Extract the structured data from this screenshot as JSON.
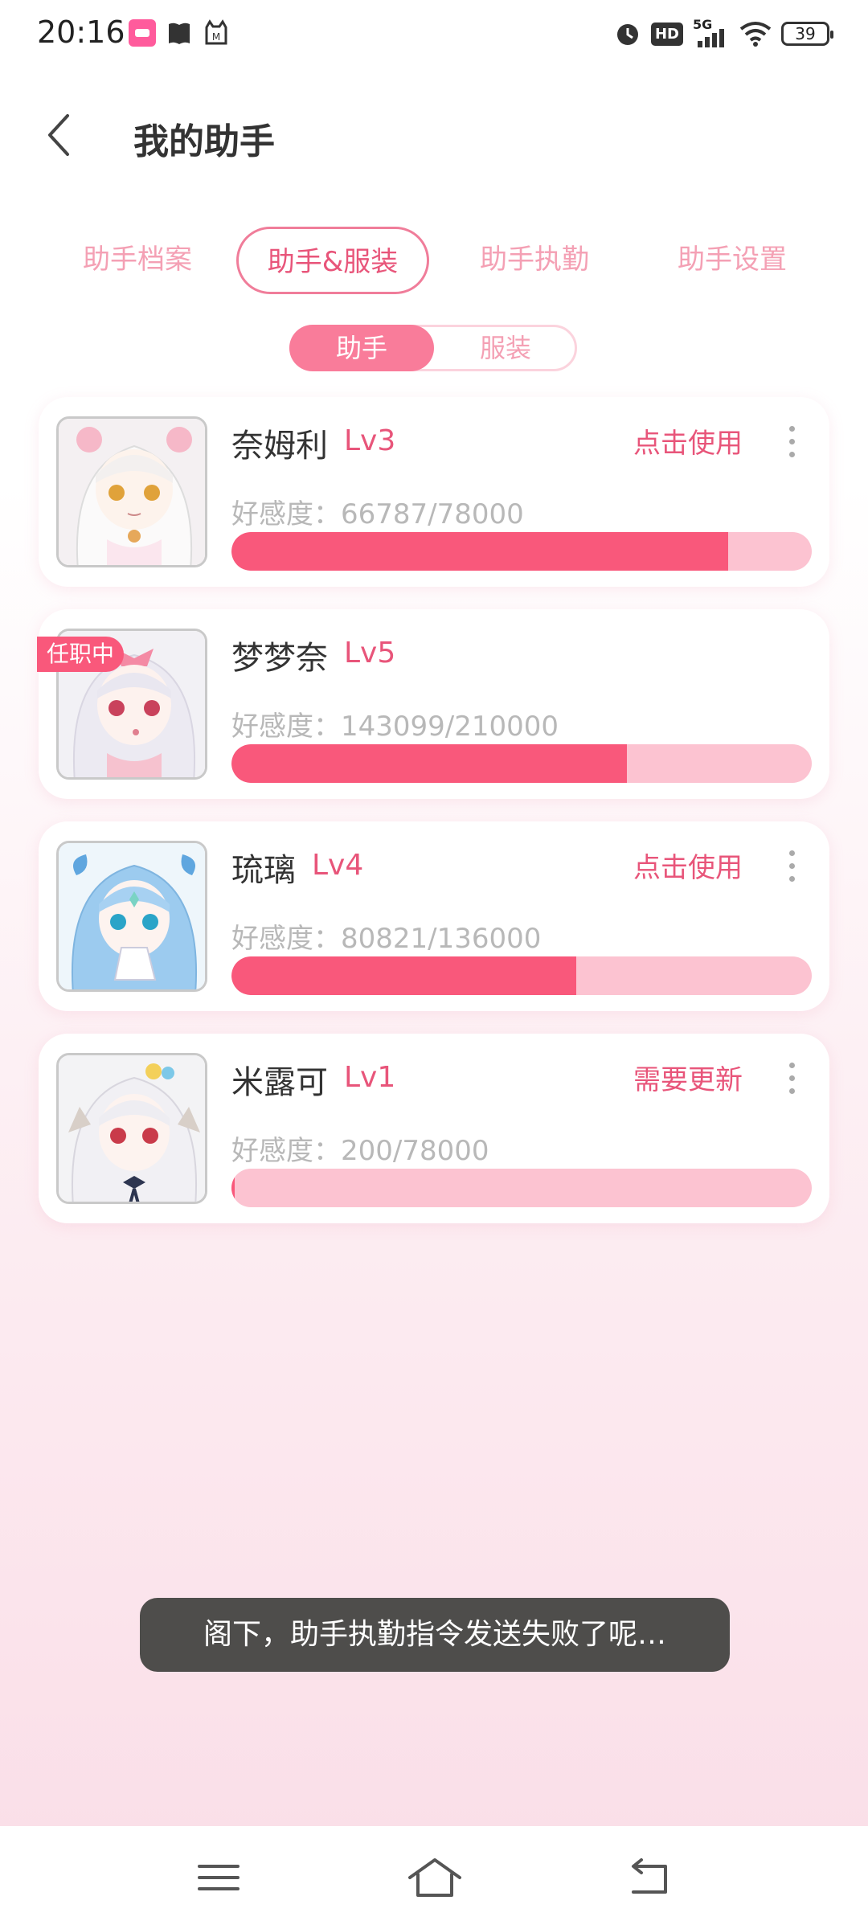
{
  "status_bar": {
    "time": "20:16",
    "network": "5G",
    "hd_label": "HD",
    "battery": "39"
  },
  "header": {
    "title": "我的助手"
  },
  "tabs": [
    {
      "label": "助手档案",
      "active": false
    },
    {
      "label": "助手&服装",
      "active": true
    },
    {
      "label": "助手执勤",
      "active": false
    },
    {
      "label": "助手设置",
      "active": false
    }
  ],
  "segment": {
    "items": [
      {
        "label": "助手",
        "active": true
      },
      {
        "label": "服装",
        "active": false
      }
    ]
  },
  "assistants": [
    {
      "name": "奈姆利",
      "level": "Lv3",
      "action": "点击使用",
      "affinity_label": "好感度：66787/78000",
      "affinity_value": 66787,
      "affinity_max": 78000,
      "badge": ""
    },
    {
      "name": "梦梦奈",
      "level": "Lv5",
      "action": "",
      "affinity_label": "好感度：143099/210000",
      "affinity_value": 143099,
      "affinity_max": 210000,
      "badge": "任职中"
    },
    {
      "name": "琉璃",
      "level": "Lv4",
      "action": "点击使用",
      "affinity_label": "好感度：80821/136000",
      "affinity_value": 80821,
      "affinity_max": 136000,
      "badge": ""
    },
    {
      "name": "米露可",
      "level": "Lv1",
      "action": "需要更新",
      "affinity_label": "好感度：200/78000",
      "affinity_value": 200,
      "affinity_max": 78000,
      "badge": ""
    }
  ],
  "toast": "阁下，助手执勤指令发送失败了呢…",
  "colors": {
    "accent": "#e8557a",
    "bar_fill": "#f9587b",
    "bar_track": "#fcc3d1",
    "tab_inactive": "#f4a0b4"
  },
  "icons": {
    "back": "chevron-left-icon",
    "more": "more-vertical-icon",
    "menu": "menu-icon",
    "home": "home-icon",
    "back_nav": "back-arrow-icon"
  }
}
